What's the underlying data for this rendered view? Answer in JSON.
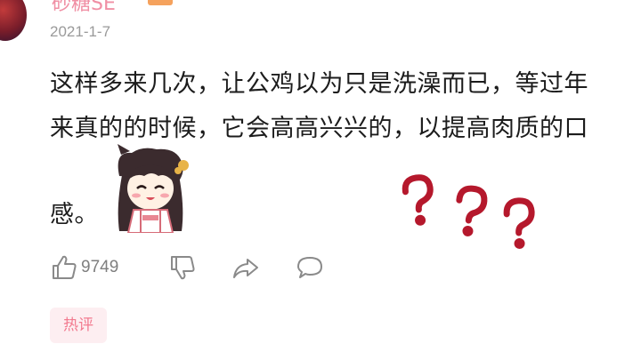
{
  "comment": {
    "username": "砂糖SE",
    "date": "2021-1-7",
    "lines": [
      "这样多来几次，让公鸡以为只是洗澡而已，等过年",
      "来真的的时候，它会高高兴兴的，以提高肉质的口",
      "感。"
    ]
  },
  "actions": {
    "like_count": "9749"
  },
  "tag": {
    "label": "热评"
  },
  "colors": {
    "username": "#f08fa4",
    "question_marks": "#b5182c",
    "tag_bg": "#fdeef1",
    "tag_text": "#f27a8f",
    "icon": "#8a8a8a"
  },
  "icons": [
    "thumbs-up-icon",
    "thumbs-down-icon",
    "share-icon",
    "comment-icon"
  ]
}
